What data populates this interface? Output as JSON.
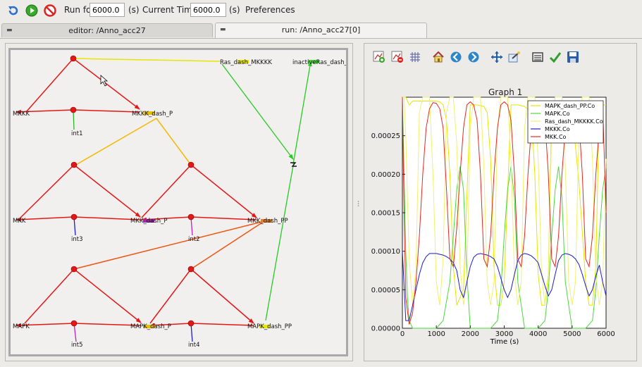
{
  "toolbar": {
    "icons": [
      "reset-icon",
      "run-icon",
      "stop-icon"
    ],
    "run_for_label": "Run for",
    "run_for_value": "6000.0",
    "run_for_unit": "(s)",
    "current_time_label": "Current Time :",
    "current_time_value": "6000.0",
    "current_time_unit": "(s)",
    "preferences_label": "Preferences"
  },
  "tabs": [
    {
      "label": "editor: /Anno_acc27",
      "active": false
    },
    {
      "label": "run: /Anno_acc27[0]",
      "active": true
    }
  ],
  "network": {
    "nodes": [
      {
        "label": "Ras_dash_MKKKK"
      },
      {
        "label": "inactiveRas_dash_MKKK"
      },
      {
        "label": "MKKK"
      },
      {
        "label": "MKKK_dash_P"
      },
      {
        "label": "int1"
      },
      {
        "label": "MKK"
      },
      {
        "label": "MKK_dash_P"
      },
      {
        "label": "MKK_dash_PP"
      },
      {
        "label": "int3"
      },
      {
        "label": "int2"
      },
      {
        "label": "MAPK"
      },
      {
        "label": "MAPK_dash_P"
      },
      {
        "label": "MAPK_dash_PP"
      },
      {
        "label": "int5"
      },
      {
        "label": "int4"
      }
    ]
  },
  "graph_tools": [
    "add-plot-icon",
    "remove-plot-icon",
    "grid-icon",
    "home-icon",
    "back-icon",
    "forward-icon",
    "pan-icon",
    "zoom-icon",
    "configure-icon",
    "check-icon",
    "save-icon"
  ],
  "chart_data": {
    "type": "line",
    "title": "Graph 1",
    "xlabel": "Time (s)",
    "ylabel": "",
    "xlim": [
      0,
      6000
    ],
    "ylim": [
      0,
      0.0003
    ],
    "xticks": [
      "0",
      "1000",
      "2000",
      "3000",
      "4000",
      "5000",
      "6000"
    ],
    "yticks": [
      "0.00000",
      "0.00005",
      "0.00010",
      "0.00015",
      "0.00020",
      "0.00025"
    ],
    "legend_position": "top-right",
    "series": [
      {
        "name": "MAPK_dash_PP.Co",
        "color": "#e6e600",
        "x": [
          0,
          100,
          200,
          300,
          400,
          600,
          800,
          1000,
          1100,
          1200,
          1300,
          1400,
          1500,
          1600,
          1800,
          2000,
          2200,
          2400,
          2500,
          2600,
          2700,
          2800,
          2900,
          3000,
          3200,
          3400,
          3600,
          3800,
          3900,
          4000,
          4100,
          4200,
          4300,
          4400,
          4600,
          4800,
          5000,
          5200,
          5400,
          5500,
          5600,
          5700,
          5800,
          5900,
          6000
        ],
        "y": [
          0.0003,
          0.0003,
          0.00029,
          0.000295,
          0.000295,
          0.000295,
          0.000295,
          0.000295,
          0.000294,
          0.00029,
          0.00027,
          0.0002,
          8e-05,
          3e-05,
          5e-05,
          0.00029,
          0.00029,
          0.000288,
          0.00028,
          0.00022,
          8e-05,
          3e-05,
          3e-05,
          6e-05,
          0.00029,
          0.00029,
          0.000288,
          0.00028,
          0.0002,
          7e-05,
          3e-05,
          3e-05,
          7e-05,
          0.00029,
          0.00029,
          0.000288,
          0.00028,
          0.00019,
          6e-05,
          3e-05,
          3e-05,
          8e-05,
          0.00029,
          0.00029,
          0.00029
        ]
      },
      {
        "name": "MAPK.Co",
        "color": "#4cd83c",
        "x": [
          0,
          50,
          100,
          150,
          200,
          300,
          400,
          600,
          800,
          1000,
          1200,
          1400,
          1500,
          1600,
          1700,
          1800,
          1900,
          2000,
          2200,
          2400,
          2600,
          2800,
          2900,
          3000,
          3100,
          3200,
          3300,
          3400,
          3600,
          3800,
          4000,
          4200,
          4300,
          4400,
          4500,
          4600,
          4700,
          4800,
          5000,
          5200,
          5400,
          5600,
          5700,
          5800,
          5900,
          6000
        ],
        "y": [
          0.0003,
          0.0002,
          0.0001,
          4e-05,
          1e-05,
          0.0,
          0.0,
          0.0,
          0.0,
          0.0,
          1e-05,
          6e-05,
          0.00012,
          0.00018,
          0.00021,
          0.00018,
          7e-05,
          0.0,
          0.0,
          0.0,
          0.0,
          1e-05,
          5e-05,
          0.00012,
          0.00018,
          0.00021,
          0.00017,
          6e-05,
          0.0,
          0.0,
          0.0,
          1e-05,
          5e-05,
          0.00012,
          0.00018,
          0.00021,
          0.00017,
          6e-05,
          0.0,
          0.0,
          0.0,
          1e-05,
          5e-05,
          0.00012,
          0.00018,
          0.00021
        ]
      },
      {
        "name": "Ras_dash_MKKKK.Co",
        "color": "#f0f070",
        "x": [
          0,
          50,
          100,
          200,
          300,
          400,
          500,
          600,
          700,
          800,
          900,
          1000,
          1100,
          1200,
          1300,
          1400,
          1500,
          1600,
          1700,
          1800,
          1900,
          2000,
          2100,
          2200,
          2300,
          2400,
          2500,
          2600,
          2700,
          2800,
          2900,
          3000,
          3100,
          3200,
          3300,
          3400,
          3500,
          3600,
          3700,
          3800,
          3900,
          4000,
          4100,
          4200,
          4300,
          4400,
          4500,
          4600,
          4700,
          4800,
          4900,
          5000,
          5100,
          5200,
          5300,
          5400,
          5500,
          5600,
          5700,
          5800,
          5900,
          6000
        ],
        "y": [
          0.0003,
          0.0003,
          0.00025,
          9e-05,
          3e-05,
          8e-05,
          0.00028,
          0.0003,
          0.0003,
          0.0003,
          0.0002,
          6e-05,
          3e-05,
          9e-05,
          0.00028,
          0.0003,
          0.0003,
          0.00024,
          8e-05,
          3e-05,
          6e-05,
          0.00026,
          0.0003,
          0.0003,
          0.0003,
          0.00021,
          6e-05,
          3e-05,
          6e-05,
          0.00026,
          0.0003,
          0.0003,
          0.0003,
          0.00022,
          7e-05,
          3e-05,
          6e-05,
          0.00026,
          0.0003,
          0.0003,
          0.0003,
          0.00022,
          7e-05,
          3e-05,
          6e-05,
          0.00026,
          0.0003,
          0.0003,
          0.0003,
          0.00021,
          6e-05,
          3e-05,
          6e-05,
          0.00026,
          0.0003,
          0.0003,
          0.0003,
          0.00022,
          7e-05,
          3e-05,
          6e-05,
          0.00022
        ]
      },
      {
        "name": "MKKK.Co",
        "color": "#1a1ad0",
        "x": [
          0,
          100,
          200,
          300,
          400,
          500,
          600,
          700,
          800,
          900,
          1000,
          1100,
          1200,
          1300,
          1400,
          1500,
          1600,
          1700,
          1800,
          1900,
          2000,
          2100,
          2200,
          2300,
          2400,
          2500,
          2600,
          2700,
          2800,
          2900,
          3000,
          3100,
          3200,
          3300,
          3400,
          3500,
          3600,
          3700,
          3800,
          3900,
          4000,
          4100,
          4200,
          4300,
          4400,
          4500,
          4600,
          4700,
          4800,
          4900,
          5000,
          5100,
          5200,
          5300,
          5400,
          5500,
          5600,
          5700,
          5800,
          5900,
          6000
        ],
        "y": [
          0.0001,
          1e-05,
          1e-05,
          3e-05,
          5e-05,
          7e-05,
          8.5e-05,
          9.3e-05,
          9.7e-05,
          9.7e-05,
          9.7e-05,
          9.6e-05,
          9.5e-05,
          9.3e-05,
          9e-05,
          8.5e-05,
          7.5e-05,
          5e-05,
          4e-05,
          6e-05,
          8e-05,
          9.2e-05,
          9.6e-05,
          9.7e-05,
          9.6e-05,
          9.5e-05,
          9.3e-05,
          9e-05,
          8e-05,
          6.5e-05,
          5e-05,
          4e-05,
          5e-05,
          7e-05,
          8.8e-05,
          9.5e-05,
          9.7e-05,
          9.6e-05,
          9.4e-05,
          9e-05,
          8.5e-05,
          7e-05,
          5.5e-05,
          4.2e-05,
          5e-05,
          7e-05,
          8.8e-05,
          9.5e-05,
          9.7e-05,
          9.6e-05,
          9.4e-05,
          9e-05,
          8.3e-05,
          7e-05,
          5.5e-05,
          4.2e-05,
          5e-05,
          6.8e-05,
          8.2e-05,
          6e-05,
          4.2e-05
        ]
      },
      {
        "name": "MKK.Co",
        "color": "#e8281e",
        "x": [
          0,
          50,
          100,
          200,
          300,
          400,
          500,
          600,
          700,
          800,
          900,
          1000,
          1100,
          1200,
          1300,
          1400,
          1500,
          1600,
          1700,
          1800,
          1900,
          2000,
          2100,
          2200,
          2300,
          2400,
          2500,
          2600,
          2700,
          2800,
          2900,
          3000,
          3100,
          3200,
          3300,
          3400,
          3500,
          3600,
          3700,
          3800,
          3900,
          4000,
          4100,
          4200,
          4300,
          4400,
          4500,
          4600,
          4700,
          4800,
          4900,
          5000,
          5100,
          5200,
          5300,
          5400,
          5500,
          5600,
          5700,
          5800,
          5900,
          6000
        ],
        "y": [
          0.0003,
          0.00015,
          4e-05,
          5e-06,
          2e-05,
          6e-05,
          0.00012,
          0.0002,
          0.00026,
          0.000285,
          0.000293,
          0.000292,
          0.000285,
          0.00026,
          0.00018,
          9e-05,
          8e-05,
          0.00013,
          0.0002,
          0.00026,
          0.00029,
          0.000294,
          0.00029,
          0.00027,
          0.0002,
          9e-05,
          8e-05,
          0.00012,
          0.0002,
          0.00026,
          0.00029,
          0.000294,
          0.00029,
          0.00027,
          0.0002,
          9e-05,
          8e-05,
          0.00012,
          0.0002,
          0.00026,
          0.00029,
          0.000294,
          0.00029,
          0.00027,
          0.0002,
          9e-05,
          8e-05,
          0.00012,
          0.0002,
          0.00026,
          0.00029,
          0.000294,
          0.00029,
          0.00027,
          0.0002,
          9e-05,
          8e-05,
          0.00012,
          0.0002,
          0.00026,
          0.00029,
          0.00015
        ]
      }
    ]
  }
}
